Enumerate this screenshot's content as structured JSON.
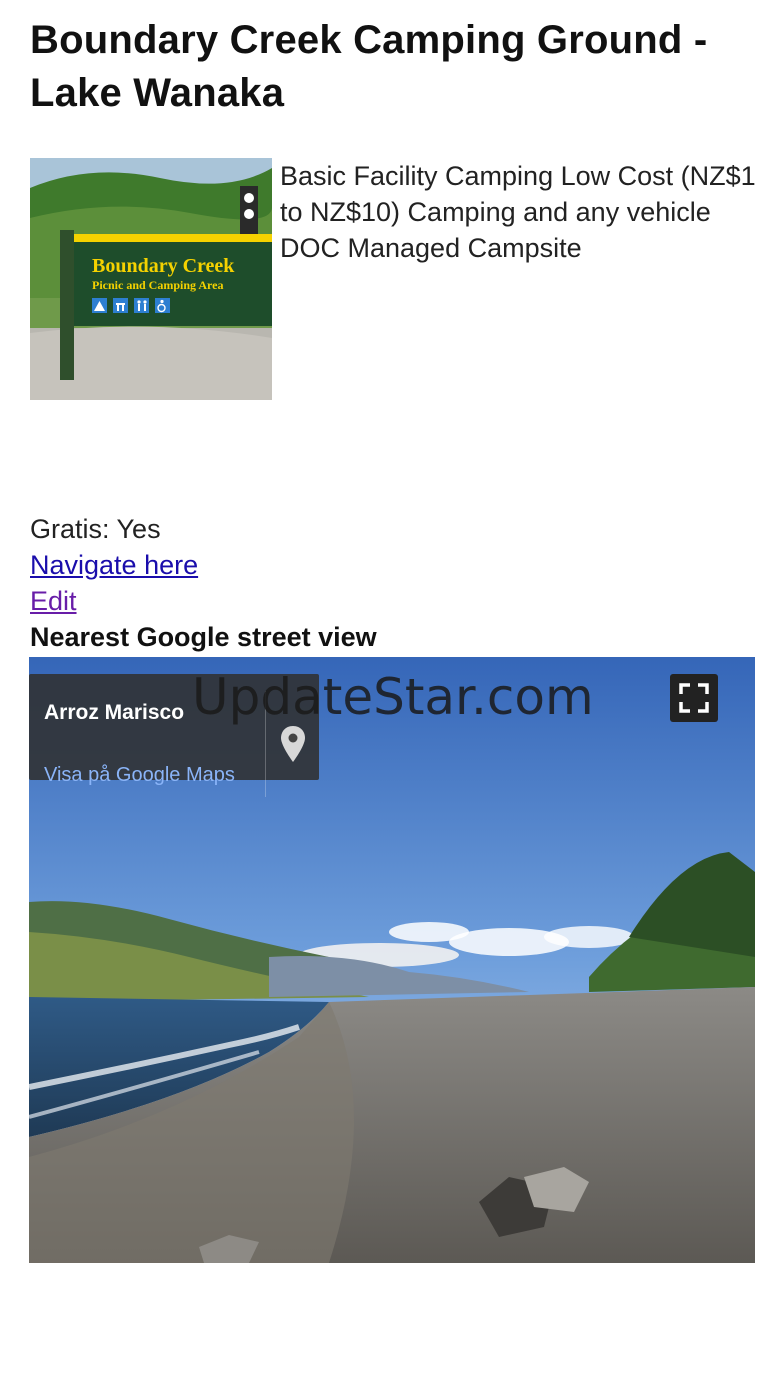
{
  "page": {
    "title": "Boundary Creek Camping Ground - Lake Wanaka",
    "description": "Basic Facility Camping Low Cost (NZ$1 to NZ$10) Camping and any vehicle DOC Managed Campsite",
    "gratis": "Gratis: Yes",
    "navigate_link": "Navigate here",
    "edit_link": "Edit",
    "street_view_heading": "Nearest Google street view"
  },
  "thumbnail": {
    "sign_title": "Boundary Creek",
    "sign_subtitle": "Picnic and Camping Area"
  },
  "street_view": {
    "place_name": "Arroz Marisco",
    "maps_link": "Visa på Google Maps"
  },
  "watermark": "UpdateStar.com",
  "colors": {
    "link": "#1a0dab",
    "visited_link": "#681da8",
    "sign_green": "#1e4d2b",
    "sign_yellow": "#f5d200"
  },
  "icons": [
    "map-pin-icon",
    "fullscreen-icon",
    "tent-icon",
    "picnic-icon",
    "toilet-icon",
    "wheelchair-icon"
  ]
}
